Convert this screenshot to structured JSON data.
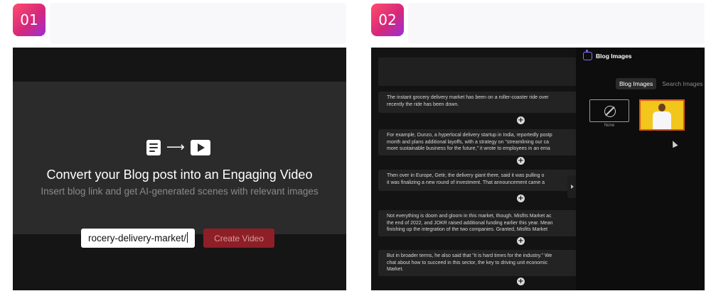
{
  "badges": {
    "step1": "01",
    "step2": "02"
  },
  "panel1": {
    "title": "Convert your Blog post into an Engaging Video",
    "subtitle": "Insert blog link and get AI-generated scenes with relevant images",
    "url_value": "rocery-delivery-market/",
    "create_button": "Create Video",
    "icons": [
      "document-icon",
      "arrow-right-icon",
      "video-play-icon"
    ]
  },
  "panel2": {
    "drawer_title": "Blog Images",
    "tabs": [
      "Blog Images",
      "Search Images"
    ],
    "none_label": "None",
    "paragraphs": [
      {
        "line1": "The instant grocery delivery market has been on a roller-coaster ride over",
        "line2": "recently the ride has been down."
      },
      {
        "line1": "For example, Dunzo, a hyperlocal delivery startup in India, reportedly postp",
        "line2": "month and plans additional layoffs, with a strategy on \"streamlining our ca",
        "line3": "more sustainable business for the future,\" it wrote to employees in an ema"
      },
      {
        "line1": "Then over in Europe, Getir, the delivery giant there, said it was pulling o",
        "line2": "it was finalizing a new round of investment. That announcement came a"
      },
      {
        "line1": "Not everything is doom and gloom in this market, though. Misfits Market ac",
        "line2": "the end of 2022, and JOKR raised additional funding earlier this year. Mean",
        "line3": "finishing up the integration of the two companies. Granted, Misfits Market"
      },
      {
        "line1": "But in broader terms, he also said that \"it is hard times for the industry.\" We",
        "line2": "chat about how to succeed in this sector, the key to driving unit economic",
        "line3": "Market."
      }
    ],
    "plus_symbol": "+",
    "icons": [
      "robot-icon",
      "ban-icon",
      "cursor-icon"
    ]
  },
  "colors": {
    "badge_start": "#ff4d6d",
    "badge_end": "#9b2fd6",
    "create_button": "#8e1f27",
    "accent": "#8b6cff",
    "thumb_bg": "#f2c61a"
  }
}
